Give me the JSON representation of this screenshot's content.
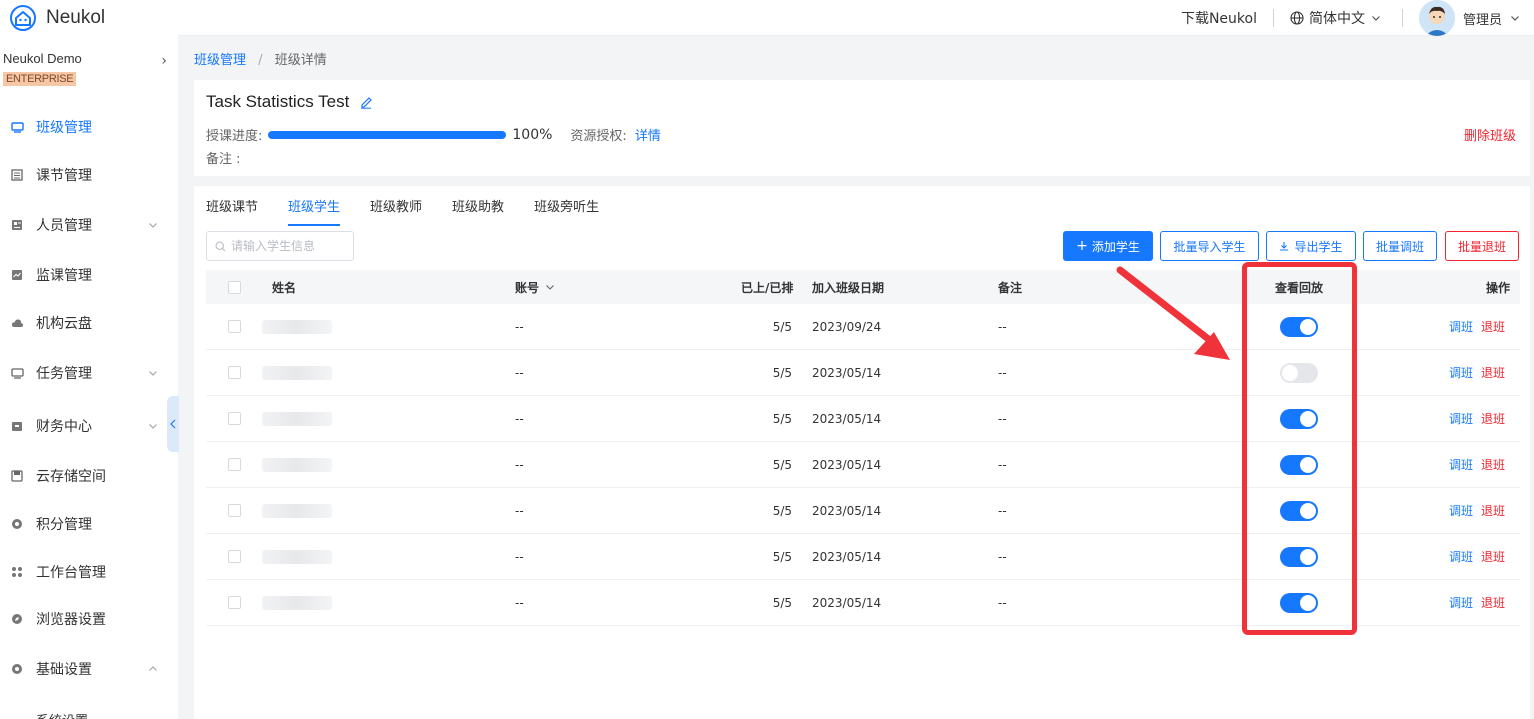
{
  "header": {
    "brand": "Neukol",
    "download": "下载Neukol",
    "language": "简体中文",
    "admin": "管理员"
  },
  "sidebar": {
    "org_name": "Neukol Demo",
    "org_badge": "ENTERPRISE",
    "items": [
      {
        "label": "班级管理",
        "icon": "class-icon",
        "active": true
      },
      {
        "label": "课节管理",
        "icon": "lesson-icon"
      },
      {
        "label": "人员管理",
        "icon": "people-icon",
        "expandable": true
      },
      {
        "label": "监课管理",
        "icon": "monitor-icon"
      },
      {
        "label": "机构云盘",
        "icon": "cloud-icon"
      },
      {
        "label": "任务管理",
        "icon": "task-icon",
        "expandable": true
      },
      {
        "label": "财务中心",
        "icon": "finance-icon",
        "expandable": true
      },
      {
        "label": "云存储空间",
        "icon": "storage-icon"
      },
      {
        "label": "积分管理",
        "icon": "points-icon"
      },
      {
        "label": "工作台管理",
        "icon": "workbench-icon"
      },
      {
        "label": "浏览器设置",
        "icon": "browser-icon"
      },
      {
        "label": "基础设置",
        "icon": "settings-icon",
        "expanded": true
      },
      {
        "label": "系统设置",
        "icon": ""
      }
    ]
  },
  "breadcrumb": {
    "parent": "班级管理",
    "current": "班级详情"
  },
  "info": {
    "title": "Task Statistics Test",
    "progress_label": "授课进度:",
    "progress_value": 1.0,
    "progress_text": "100%",
    "resource_label": "资源授权:",
    "resource_link": "详情",
    "remark_label": "备注 :",
    "delete": "删除班级"
  },
  "tabs": [
    {
      "label": "班级课节"
    },
    {
      "label": "班级学生",
      "active": true
    },
    {
      "label": "班级教师"
    },
    {
      "label": "班级助教"
    },
    {
      "label": "班级旁听生"
    }
  ],
  "toolbar": {
    "search_placeholder": "请输入学生信息",
    "add": "添加学生",
    "batch_import": "批量导入学生",
    "export": "导出学生",
    "batch_adjust": "批量调班",
    "batch_quit": "批量退班"
  },
  "table": {
    "headers": {
      "name": "姓名",
      "account": "账号",
      "progress": "已上/已排",
      "join_date": "加入班级日期",
      "remark": "备注",
      "playback": "查看回放",
      "ops": "操作"
    },
    "rows": [
      {
        "account": "--",
        "progress": "5/5",
        "date": "2023/09/24",
        "remark": "--",
        "playback": true
      },
      {
        "account": "--",
        "progress": "5/5",
        "date": "2023/05/14",
        "remark": "--",
        "playback": false
      },
      {
        "account": "--",
        "progress": "5/5",
        "date": "2023/05/14",
        "remark": "--",
        "playback": true
      },
      {
        "account": "--",
        "progress": "5/5",
        "date": "2023/05/14",
        "remark": "--",
        "playback": true
      },
      {
        "account": "--",
        "progress": "5/5",
        "date": "2023/05/14",
        "remark": "--",
        "playback": true
      },
      {
        "account": "--",
        "progress": "5/5",
        "date": "2023/05/14",
        "remark": "--",
        "playback": true
      },
      {
        "account": "--",
        "progress": "5/5",
        "date": "2023/05/14",
        "remark": "--",
        "playback": true
      }
    ],
    "op_adjust": "调班",
    "op_quit": "退班"
  },
  "colors": {
    "primary": "#1677ff",
    "danger": "#f5222d",
    "annotation": "#f0323a"
  }
}
